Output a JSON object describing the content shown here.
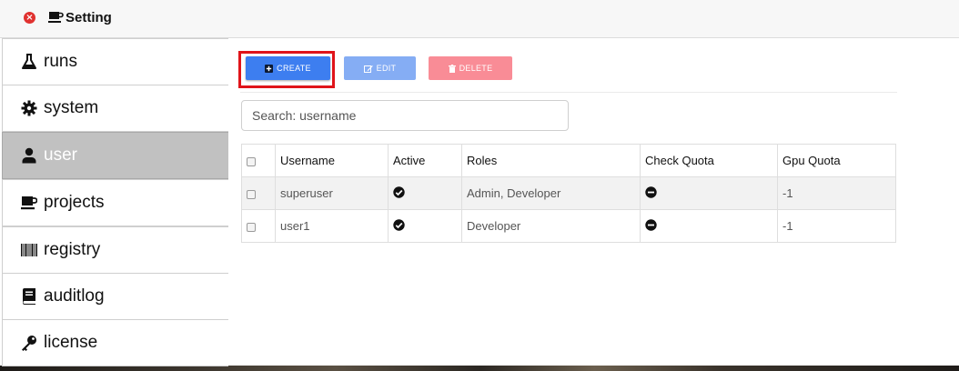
{
  "window": {
    "title": "Setting"
  },
  "sidebar": {
    "items": [
      {
        "label": "runs",
        "icon": "flask-icon"
      },
      {
        "label": "system",
        "icon": "gear-icon"
      },
      {
        "label": "user",
        "icon": "user-icon",
        "active": true
      },
      {
        "label": "projects",
        "icon": "coffee-icon"
      },
      {
        "label": "registry",
        "icon": "barcode-icon"
      },
      {
        "label": "auditlog",
        "icon": "book-icon"
      },
      {
        "label": "license",
        "icon": "key-icon"
      }
    ]
  },
  "toolbar": {
    "create_label": "CREATE",
    "edit_label": "EDIT",
    "delete_label": "DELETE"
  },
  "search": {
    "placeholder": "Search: username",
    "value": ""
  },
  "table": {
    "headers": [
      "",
      "Username",
      "Active",
      "Roles",
      "Check Quota",
      "Gpu Quota"
    ],
    "rows": [
      {
        "username": "superuser",
        "active": "check-circle-icon",
        "roles": "Admin, Developer",
        "check_quota": "minus-circle-icon",
        "gpu_quota": "-1"
      },
      {
        "username": "user1",
        "active": "check-circle-icon",
        "roles": "Developer",
        "check_quota": "minus-circle-icon",
        "gpu_quota": "-1"
      }
    ]
  },
  "colors": {
    "primary": "#3d7ef0",
    "edit_disabled": "#85adf4",
    "delete_disabled": "#f98c96",
    "active_nav": "#c1c1c1",
    "highlight": "#e0141a",
    "close": "#e0312f"
  }
}
